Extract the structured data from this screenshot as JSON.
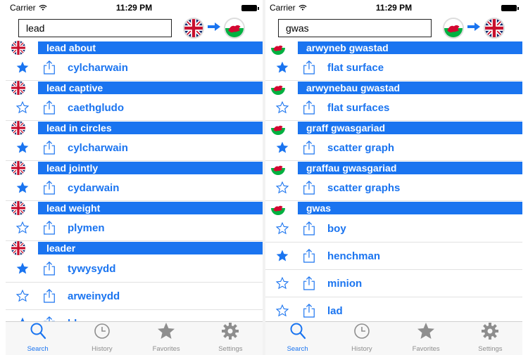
{
  "status": {
    "carrier": "Carrier",
    "time": "11:29 PM"
  },
  "tabs": [
    {
      "label": "Search",
      "icon": "search-icon",
      "active": true
    },
    {
      "label": "History",
      "icon": "clock-icon",
      "active": false
    },
    {
      "label": "Favorites",
      "icon": "star-icon",
      "active": false
    },
    {
      "label": "Settings",
      "icon": "gear-icon",
      "active": false
    }
  ],
  "colors": {
    "accent": "#1a74f0",
    "header_bar": "#1a74f0",
    "tab_inactive": "#8e8e8e"
  },
  "left": {
    "query": "lead",
    "from_flag": "uk-flag-icon",
    "to_flag": "wales-flag-icon",
    "entries": [
      {
        "header": "lead about",
        "flag": "uk",
        "results": [
          {
            "word": "cylcharwain",
            "favorite": true
          }
        ]
      },
      {
        "header": "lead captive",
        "flag": "uk",
        "results": [
          {
            "word": "caethgludo",
            "favorite": false
          }
        ]
      },
      {
        "header": "lead in circles",
        "flag": "uk",
        "results": [
          {
            "word": "cylcharwain",
            "favorite": true
          }
        ]
      },
      {
        "header": "lead jointly",
        "flag": "uk",
        "results": [
          {
            "word": "cydarwain",
            "favorite": true
          }
        ]
      },
      {
        "header": "lead weight",
        "flag": "uk",
        "results": [
          {
            "word": "plymen",
            "favorite": false
          }
        ]
      },
      {
        "header": "leader",
        "flag": "uk",
        "results": [
          {
            "word": "tywysydd",
            "favorite": true
          },
          {
            "word": "arweinydd",
            "favorite": false
          },
          {
            "word": "blaenor",
            "favorite": true
          }
        ]
      }
    ]
  },
  "right": {
    "query": "gwas",
    "from_flag": "wales-flag-icon",
    "to_flag": "uk-flag-icon",
    "entries": [
      {
        "header": "arwyneb gwastad",
        "flag": "wales",
        "results": [
          {
            "word": "flat surface",
            "favorite": true
          }
        ]
      },
      {
        "header": "arwynebau gwastad",
        "flag": "wales",
        "results": [
          {
            "word": "flat surfaces",
            "favorite": false
          }
        ]
      },
      {
        "header": "graff gwasgariad",
        "flag": "wales",
        "results": [
          {
            "word": "scatter graph",
            "favorite": true
          }
        ]
      },
      {
        "header": "graffau gwasgariad",
        "flag": "wales",
        "results": [
          {
            "word": "scatter graphs",
            "favorite": false
          }
        ]
      },
      {
        "header": "gwas",
        "flag": "wales",
        "results": [
          {
            "word": "boy",
            "favorite": false
          },
          {
            "word": "henchman",
            "favorite": true
          },
          {
            "word": "minion",
            "favorite": false
          },
          {
            "word": "lad",
            "favorite": false
          }
        ]
      }
    ]
  }
}
